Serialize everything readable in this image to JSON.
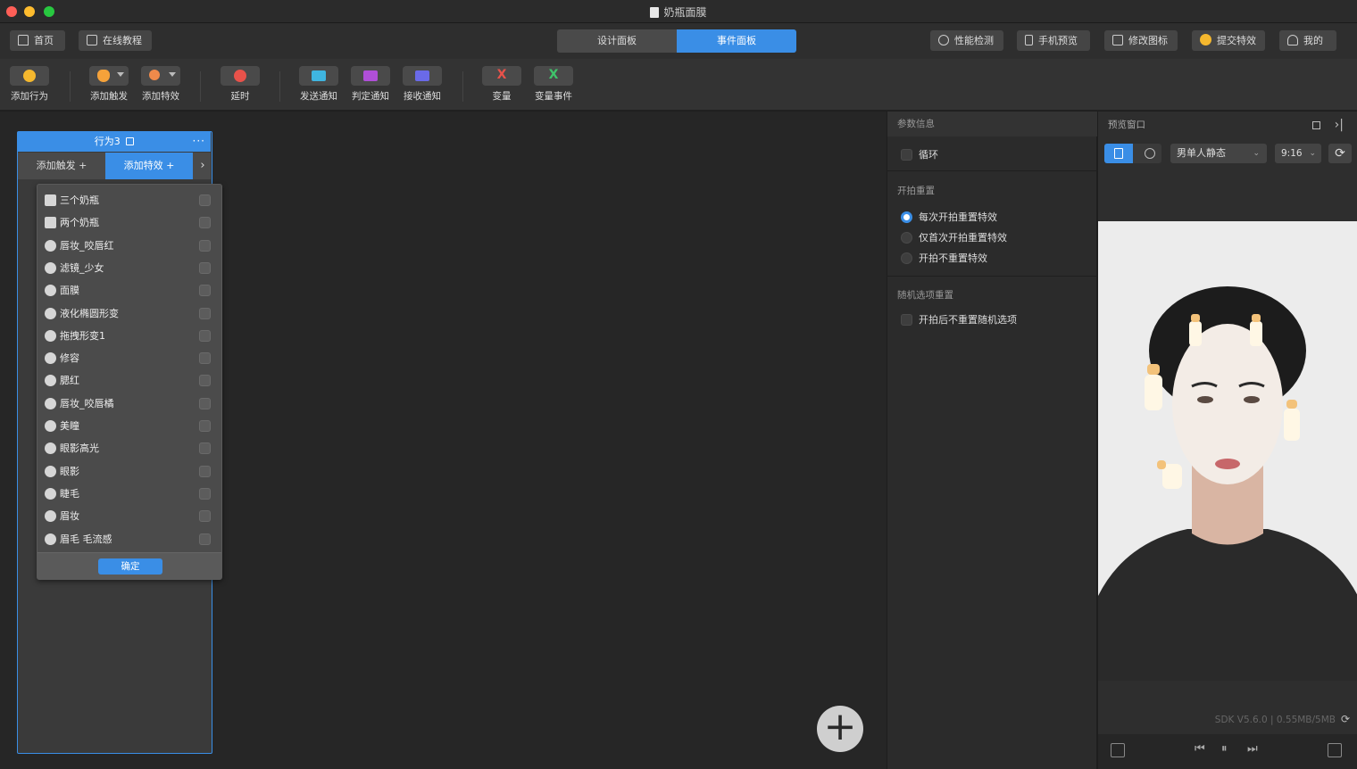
{
  "window": {
    "title": "奶瓶面膜",
    "colors": {
      "close": "#fe5f57",
      "minimize": "#febc2e",
      "maximize": "#28c840",
      "accent": "#3a8ee6"
    }
  },
  "nav": {
    "home": "首页",
    "tutorial": "在线教程",
    "design_tab": "设计面板",
    "event_tab": "事件面板",
    "perf": "性能检测",
    "mobile": "手机预览",
    "icon": "修改图标",
    "submit": "提交特效",
    "me": "我的"
  },
  "toolbar": {
    "add_behavior": "添加行为",
    "add_trigger": "添加触发",
    "add_effect": "添加特效",
    "delay": "延时",
    "send_notify": "发送通知",
    "judge_notify": "判定通知",
    "receive_notify": "接收通知",
    "variable": "变量",
    "variable_event": "变量事件"
  },
  "card": {
    "title": "行为3",
    "tab_trigger": "添加触发 +",
    "tab_effect": "添加特效 +"
  },
  "dropdown": {
    "items": [
      {
        "label": "三个奶瓶",
        "icon": "sticker-icon"
      },
      {
        "label": "两个奶瓶",
        "icon": "sticker-icon"
      },
      {
        "label": "唇妆_咬唇红",
        "icon": "makeup-icon"
      },
      {
        "label": "滤镜_少女",
        "icon": "filter-icon"
      },
      {
        "label": "面膜",
        "icon": "makeup-icon"
      },
      {
        "label": "液化椭圆形变",
        "icon": "deform-icon"
      },
      {
        "label": "拖拽形变1",
        "icon": "deform-icon"
      },
      {
        "label": "修容",
        "icon": "makeup-icon"
      },
      {
        "label": "腮红",
        "icon": "makeup-icon"
      },
      {
        "label": "唇妆_咬唇橘",
        "icon": "makeup-icon"
      },
      {
        "label": "美瞳",
        "icon": "makeup-icon"
      },
      {
        "label": "眼影高光",
        "icon": "makeup-icon"
      },
      {
        "label": "眼影",
        "icon": "makeup-icon"
      },
      {
        "label": "睫毛",
        "icon": "makeup-icon"
      },
      {
        "label": "眉妆",
        "icon": "makeup-icon"
      },
      {
        "label": "眉毛 毛流感",
        "icon": "makeup-icon"
      }
    ],
    "confirm": "确定"
  },
  "params": {
    "header": "参数信息",
    "loop": "循环",
    "reset_header": "开拍重置",
    "reset_every": "每次开拍重置特效",
    "reset_first": "仅首次开拍重置特效",
    "reset_none": "开拍不重置特效",
    "random_header": "随机选项重置",
    "random_none": "开拍后不重置随机选项"
  },
  "preview": {
    "header": "预览窗口",
    "model": "男单人静态",
    "ratio": "9:16",
    "sdk": "SDK V5.6.0 | 0.55MB/5MB"
  }
}
